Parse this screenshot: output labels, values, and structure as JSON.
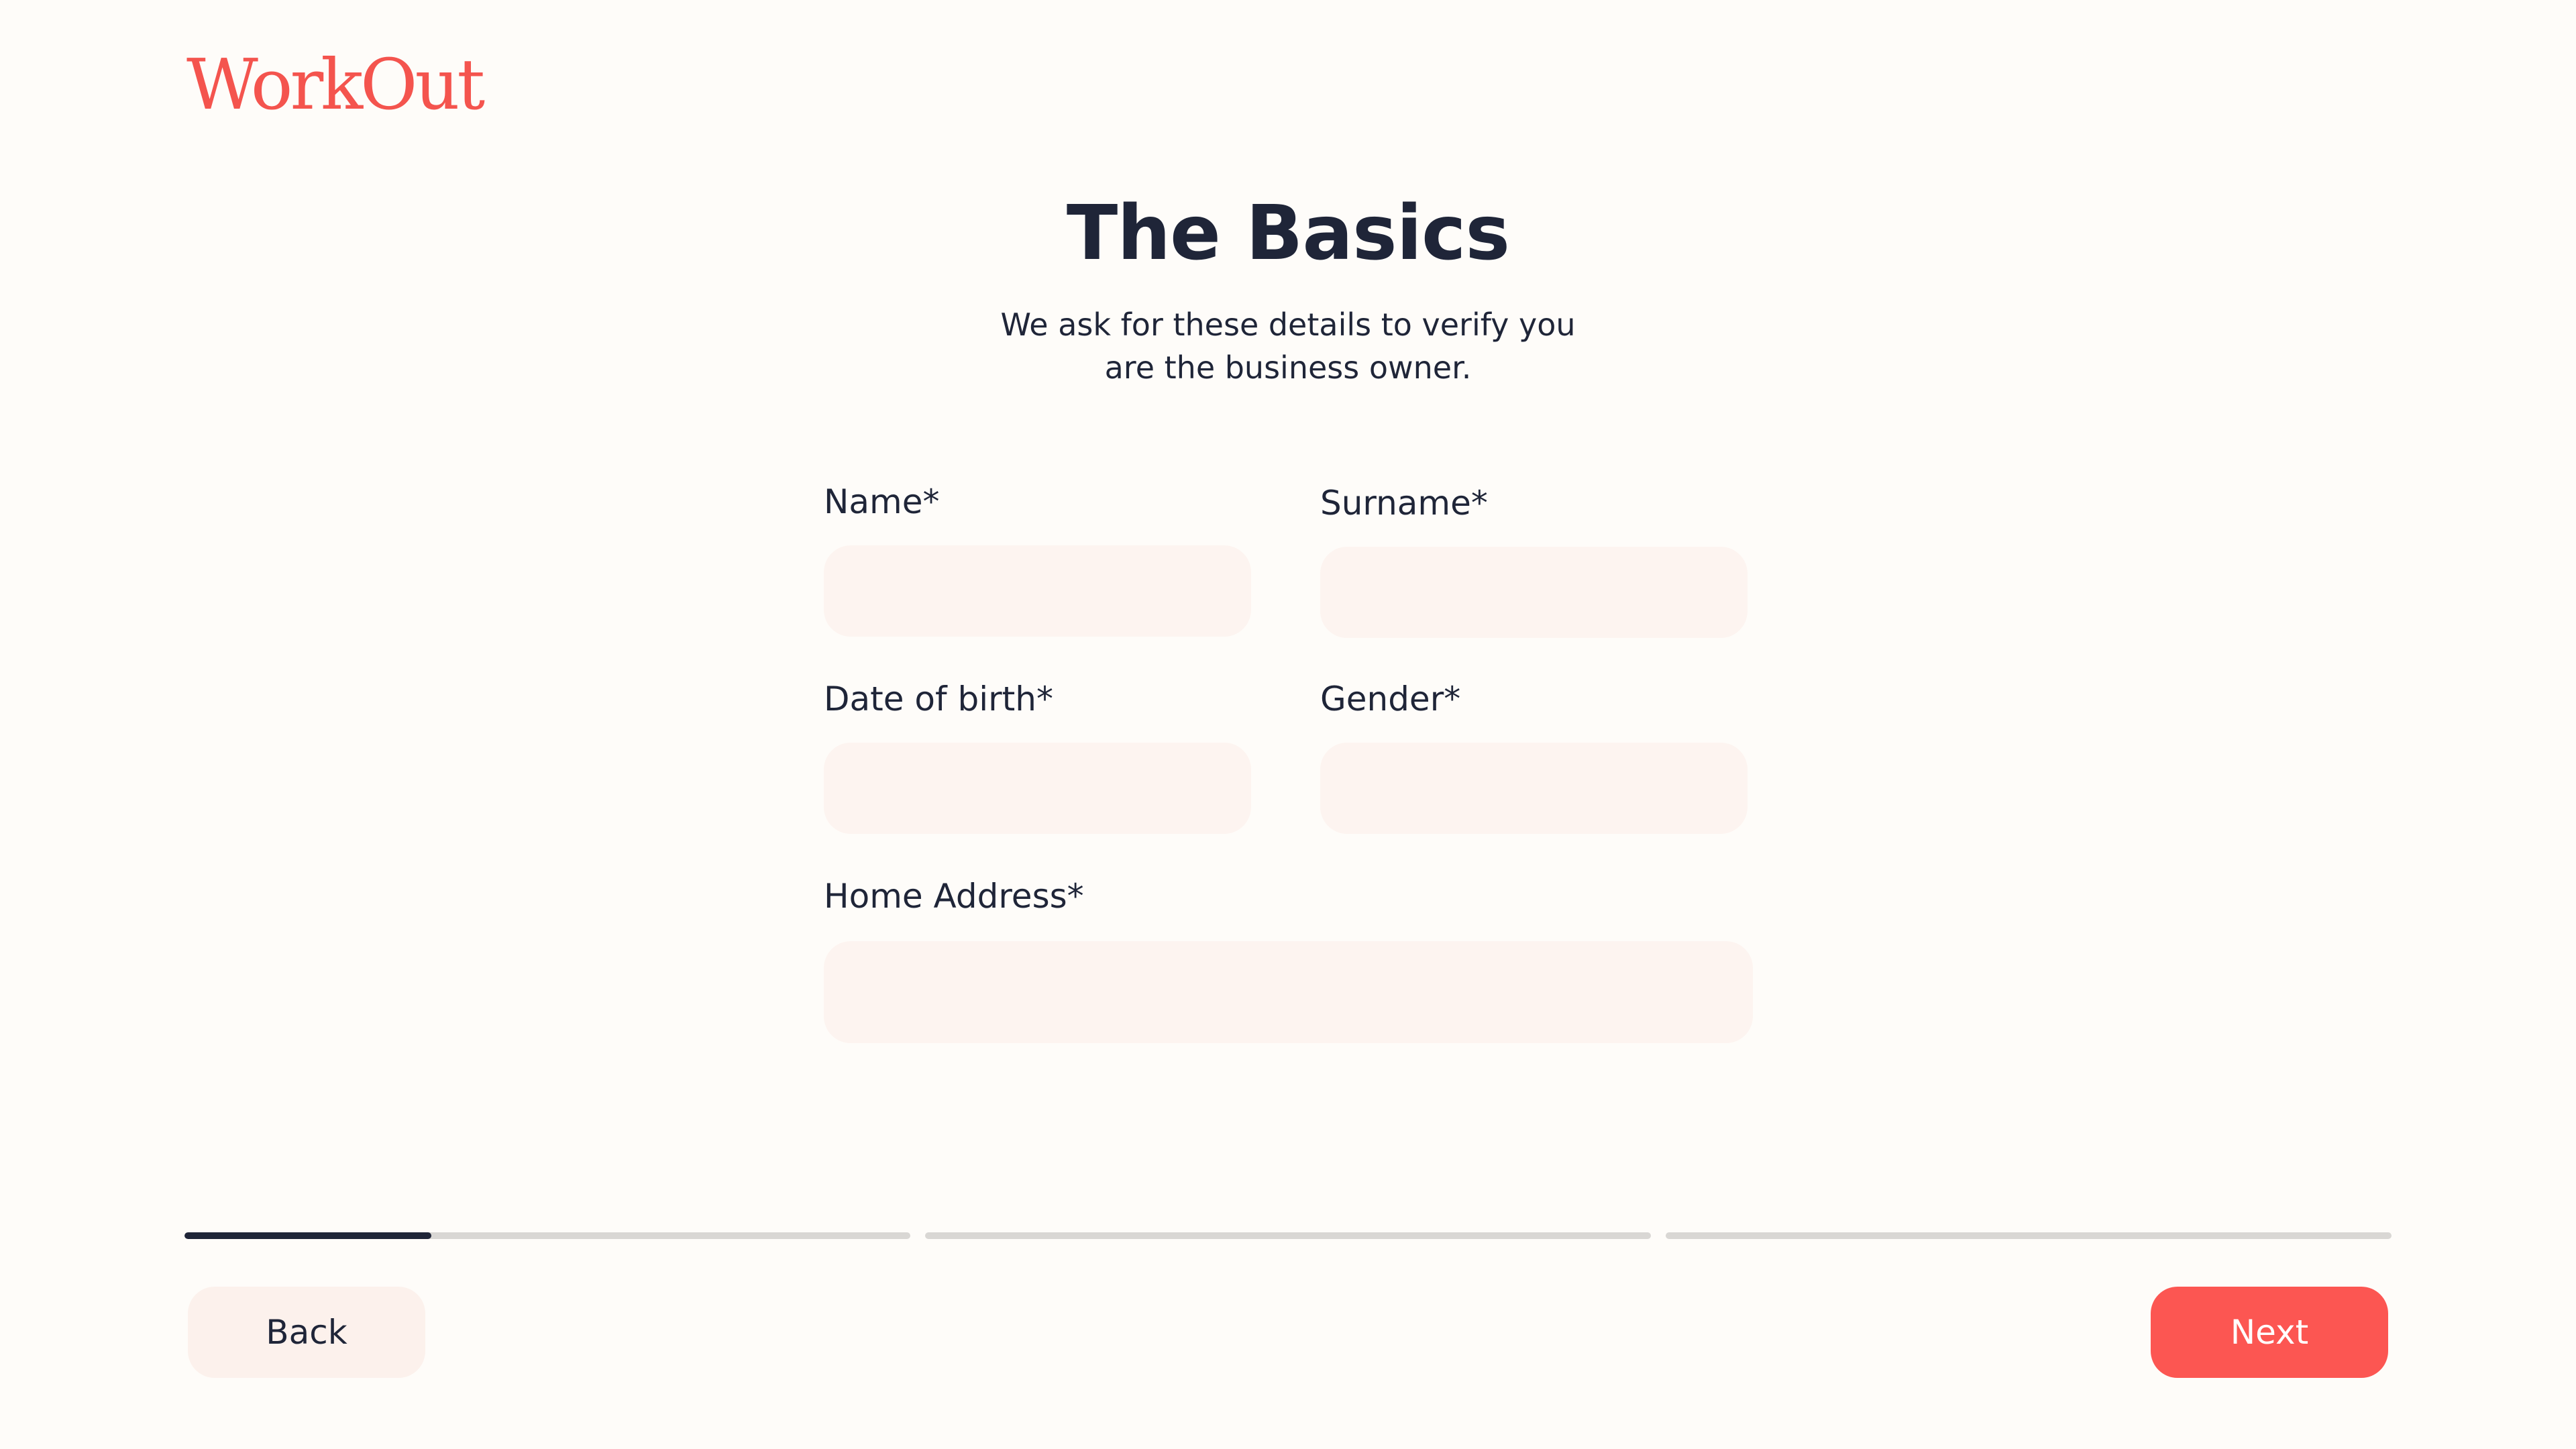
{
  "app": {
    "logo_text": "WorkOut",
    "brand_color": "#f4544e",
    "accent_color": "#fc5652",
    "text_color": "#1f2538",
    "background_color": "#fefcf9",
    "input_background": "#fdf4f0"
  },
  "header": {
    "title": "The Basics",
    "subtitle_line1": "We ask for these details to verify you",
    "subtitle_line2": "are the business owner."
  },
  "form": {
    "name_label": "Name*",
    "name_value": "",
    "surname_label": "Surname*",
    "surname_value": "",
    "dob_label": "Date of birth*",
    "dob_value": "",
    "gender_label": "Gender*",
    "gender_value": "",
    "address_label": "Home Address*",
    "address_value": ""
  },
  "progress": {
    "total_steps": 3,
    "current_step": 1,
    "step_fill": [
      0.34,
      0,
      0
    ]
  },
  "footer": {
    "back_label": "Back",
    "next_label": "Next"
  }
}
